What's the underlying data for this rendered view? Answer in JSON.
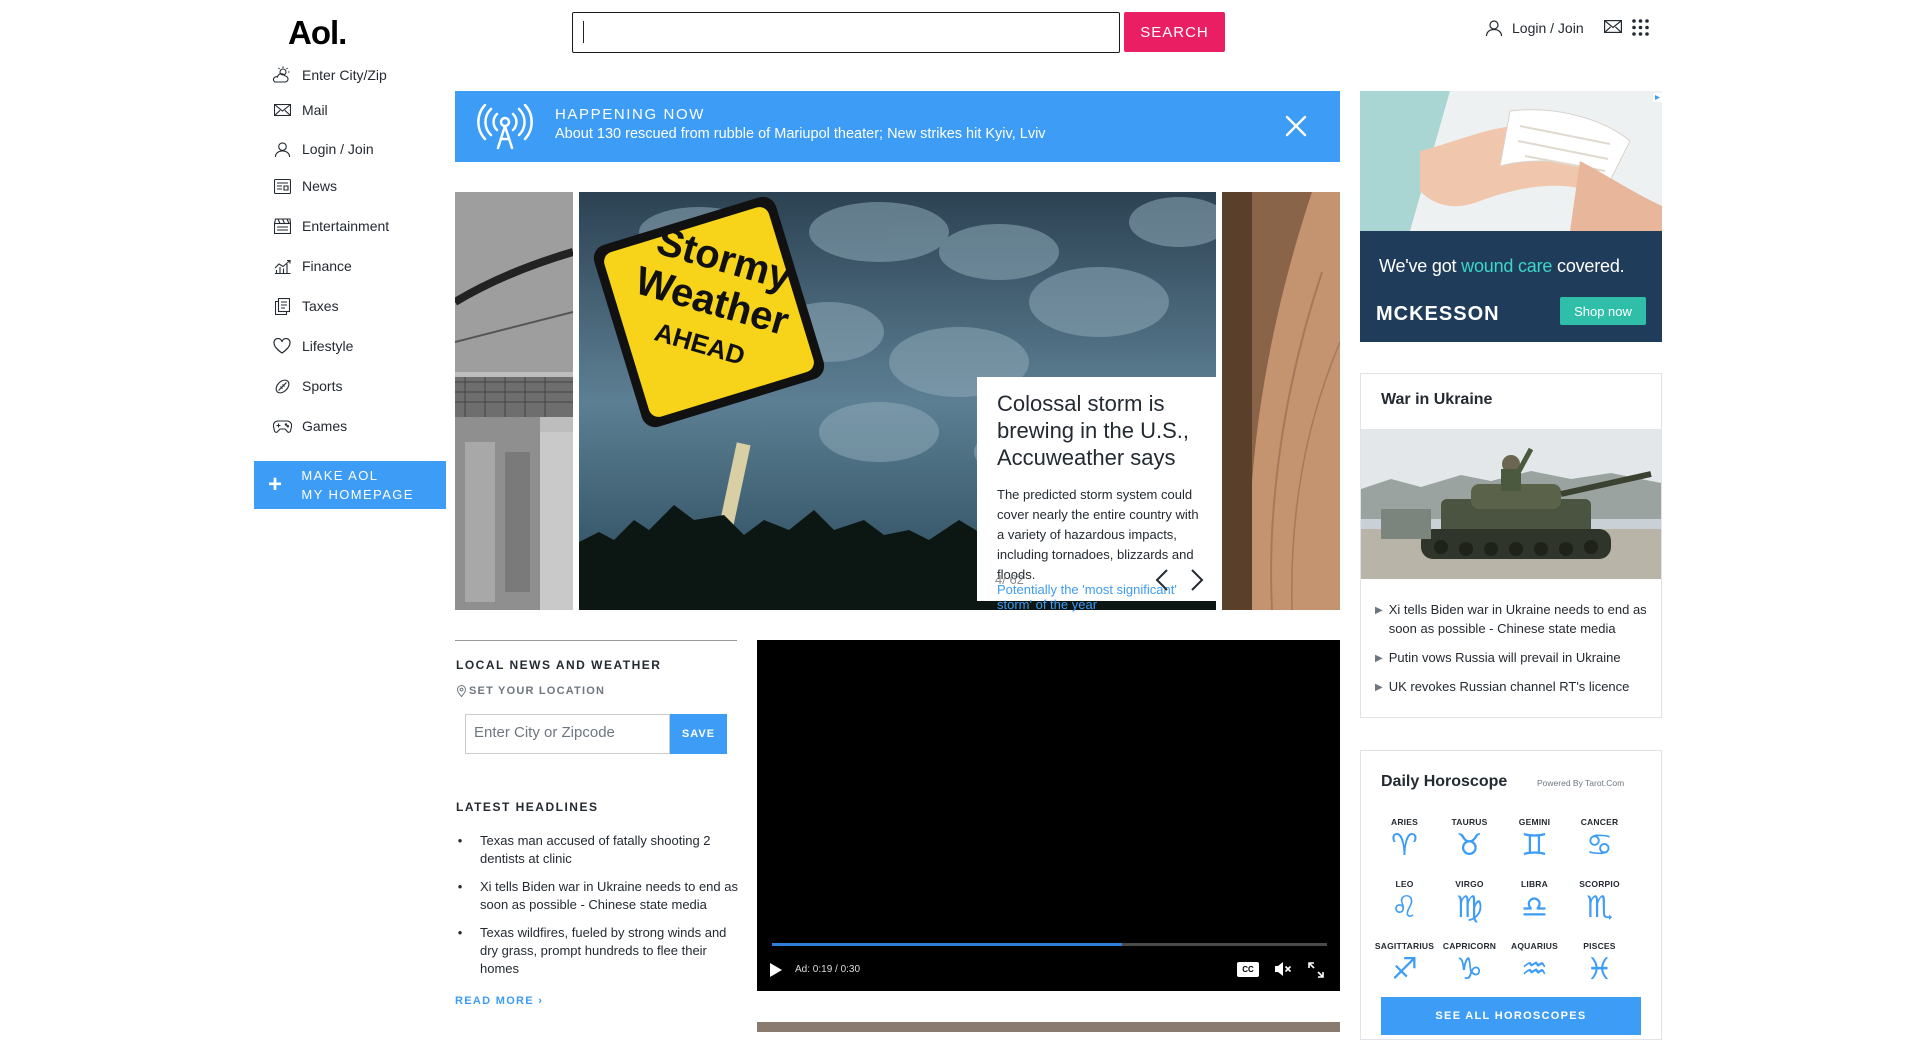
{
  "header": {
    "logo": "Aol.",
    "search_placeholder": "",
    "search_button": "SEARCH",
    "user_label": "Login / Join"
  },
  "nav": {
    "items": [
      {
        "label": "Enter City/Zip",
        "icon": "weather-icon"
      },
      {
        "label": "Mail",
        "icon": "mail-icon"
      },
      {
        "label": "Login / Join",
        "icon": "user-icon"
      },
      {
        "label": "News",
        "icon": "news-icon"
      },
      {
        "label": "Entertainment",
        "icon": "entertainment-icon"
      },
      {
        "label": "Finance",
        "icon": "finance-icon"
      },
      {
        "label": "Taxes",
        "icon": "taxes-icon"
      },
      {
        "label": "Lifestyle",
        "icon": "heart-icon"
      },
      {
        "label": "Sports",
        "icon": "sports-icon"
      },
      {
        "label": "Games",
        "icon": "gamepad-icon"
      }
    ],
    "make_homepage_line1": "MAKE AOL",
    "make_homepage_line2": "MY HOMEPAGE"
  },
  "banner": {
    "label": "HAPPENING NOW",
    "headline": "About 130 rescued from rubble of Mariupol theater; New strikes hit Kyiv, Lviv"
  },
  "hero": {
    "sign_line1": "Stormy",
    "sign_line2": "Weather",
    "sign_line3": "AHEAD",
    "title": "Colossal storm is brewing in the U.S., Accuweather says",
    "description": "The predicted storm system could cover nearly the entire country with a variety of hazardous impacts, including tornadoes, blizzards and floods.",
    "link": "Potentially the 'most significant' storm' of the year",
    "counter": "4/ 62"
  },
  "local": {
    "heading": "LOCAL NEWS AND WEATHER",
    "set_location": "SET YOUR LOCATION",
    "zip_placeholder": "Enter City or Zipcode",
    "save": "SAVE",
    "latest_heading": "LATEST HEADLINES",
    "headlines": [
      "Texas man accused of fatally shooting 2 dentists at clinic",
      "Xi tells Biden war in Ukraine needs to end as soon as possible - Chinese state media",
      "Texas wildfires, fueled by strong winds and dry grass, prompt hundreds to flee their homes"
    ],
    "read_more": "READ MORE ›"
  },
  "video": {
    "time": "Ad: 0:19 / 0:30",
    "progress": 0.63,
    "cc": "CC"
  },
  "ad": {
    "tagline_pre": "We've got ",
    "tagline_em": "wound care",
    "tagline_post": " covered.",
    "brand": "MCKESSON",
    "cta": "Shop now"
  },
  "ukraine": {
    "title": "War in Ukraine",
    "items": [
      "Xi tells Biden war in Ukraine needs to end as soon as possible - Chinese state media",
      "Putin vows Russia will prevail in Ukraine",
      "UK revokes Russian channel RT's licence"
    ]
  },
  "horoscope": {
    "title": "Daily Horoscope",
    "powered": "Powered By Tarot.Com",
    "signs": [
      {
        "name": "ARIES",
        "glyph": "♈"
      },
      {
        "name": "TAURUS",
        "glyph": "♉"
      },
      {
        "name": "GEMINI",
        "glyph": "♊"
      },
      {
        "name": "CANCER",
        "glyph": "♋"
      },
      {
        "name": "LEO",
        "glyph": "♌"
      },
      {
        "name": "VIRGO",
        "glyph": "♍"
      },
      {
        "name": "LIBRA",
        "glyph": "♎"
      },
      {
        "name": "SCORPIO",
        "glyph": "♏"
      },
      {
        "name": "SAGITTARIUS",
        "glyph": "♐"
      },
      {
        "name": "CAPRICORN",
        "glyph": "♑"
      },
      {
        "name": "AQUARIUS",
        "glyph": "♒"
      },
      {
        "name": "PISCES",
        "glyph": "♓"
      }
    ],
    "button": "SEE ALL HOROSCOPES"
  },
  "colors": {
    "accent_blue": "#3d9cf5",
    "search_pink": "#e91e63",
    "ad_teal": "#2fbfa9"
  }
}
